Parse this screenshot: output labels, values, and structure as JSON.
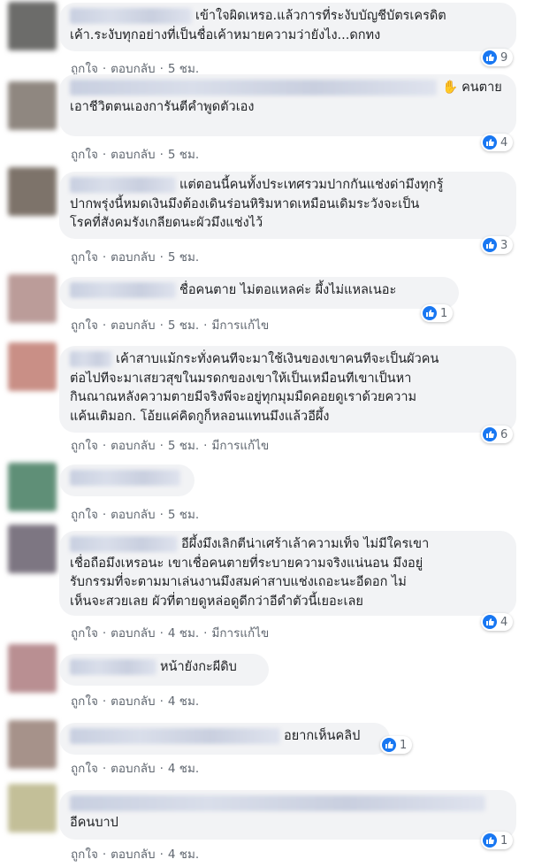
{
  "actions": {
    "like": "ถูกใจ",
    "reply": "ตอบกลับ",
    "edited": "มีการแก้ไข",
    "sep": "·"
  },
  "comments": [
    {
      "lines": [
        "เข้าใจผิดเหรอ.แล้วการที่ระงับบัญชีบัตรเครดิต",
        "เค้า.ระงับทุกอย่างที่เป็นชื่อเค้าหมายความว่ายังไง...ดกทง"
      ],
      "time": "5 ชม.",
      "reactions": "9",
      "avatar_color": "#6c6c6a"
    },
    {
      "lines": [
        "คนตาย",
        "เอาชีวิตตนเองการันตีคำพูดตัวเอง"
      ],
      "time": "5 ชม.",
      "reactions": "4",
      "avatar_color": "#8f8780",
      "icon": "waving-hand-icon"
    },
    {
      "lines": [
        "แต่ตอนนี้คนทั้งประเทศรวมปากกันแช่งด่ามึงทุกรู้",
        "ปากพรุ่งนี้หมดเงินมึงต้องเดินร่อนหิริมหาดเหมือนเดิมระวังจะเป็น",
        "โรคที่สังคมรังเกลียดนะผัวมึงแช่งไว้"
      ],
      "time": "5 ชม.",
      "reactions": "3",
      "avatar_color": "#7d736a"
    },
    {
      "lines": [
        "ชื่อคนตาย ไม่ตอแหลค่ะ ผึ้งไม่แหลเนอะ"
      ],
      "time": "5 ชม.",
      "reactions": "1",
      "avatar_color": "#bb9c99",
      "edited": true
    },
    {
      "lines": [
        "เค้าสาบแม้กระทั่งคนทีจะมาใช้เงินของเขาคนทีจะเป็นผัวคน",
        "ต่อไปทีจะมาเสยวสุขในมรดกของเขาให้เป็นเหมือนทีเขาเป็นหา",
        "กินณาณหลังความตายมีจริงพีจะอยู่ทุกมุมมืดคอยดูเราด้วยความ",
        "แค้นเติมอก. โอ้ยแค่คิดกูก็หลอนแทนมึงแล้วอีผึ้ง"
      ],
      "time": "5 ชม.",
      "reactions": "6",
      "avatar_color": "#c98f86",
      "edited": true
    },
    {
      "lines": [
        ""
      ],
      "time": "5 ชม.",
      "reactions": "",
      "avatar_color": "#5f8f77"
    },
    {
      "lines": [
        "อีผึ้งมึงเลิกตีน่าเศร้าเล้าความเท็จ ไม่มีใครเขา",
        "เชื่อถือมึงเหรอนะ เขาเชื่อคนตายที่ระบายความจริงแน่นอน มึงอยู่",
        "รับกรรมที่จะตามมาเล่นงานมึงสมค่าสาบแช่งเถอะนะอีดอก ไม่",
        "เห็นจะสวยเลย ผัวที่ตายดูหล่อดูดีกว่าอีดำตัวนี้เยอะเลย"
      ],
      "time": "4 ชม.",
      "reactions": "4",
      "avatar_color": "#7d7682",
      "edited": true
    },
    {
      "lines": [
        "หน้ายังกะผีดิบ"
      ],
      "time": "4 ชม.",
      "reactions": "",
      "avatar_color": "#b98f92"
    },
    {
      "lines": [
        "อยากเห็นคลิป"
      ],
      "time": "4 ชม.",
      "reactions": "1",
      "avatar_color": "#a6928a"
    },
    {
      "lines": [
        "",
        "อีคนบาป"
      ],
      "time": "4 ชม.",
      "reactions": "1",
      "avatar_color": "#c3bf98"
    }
  ]
}
